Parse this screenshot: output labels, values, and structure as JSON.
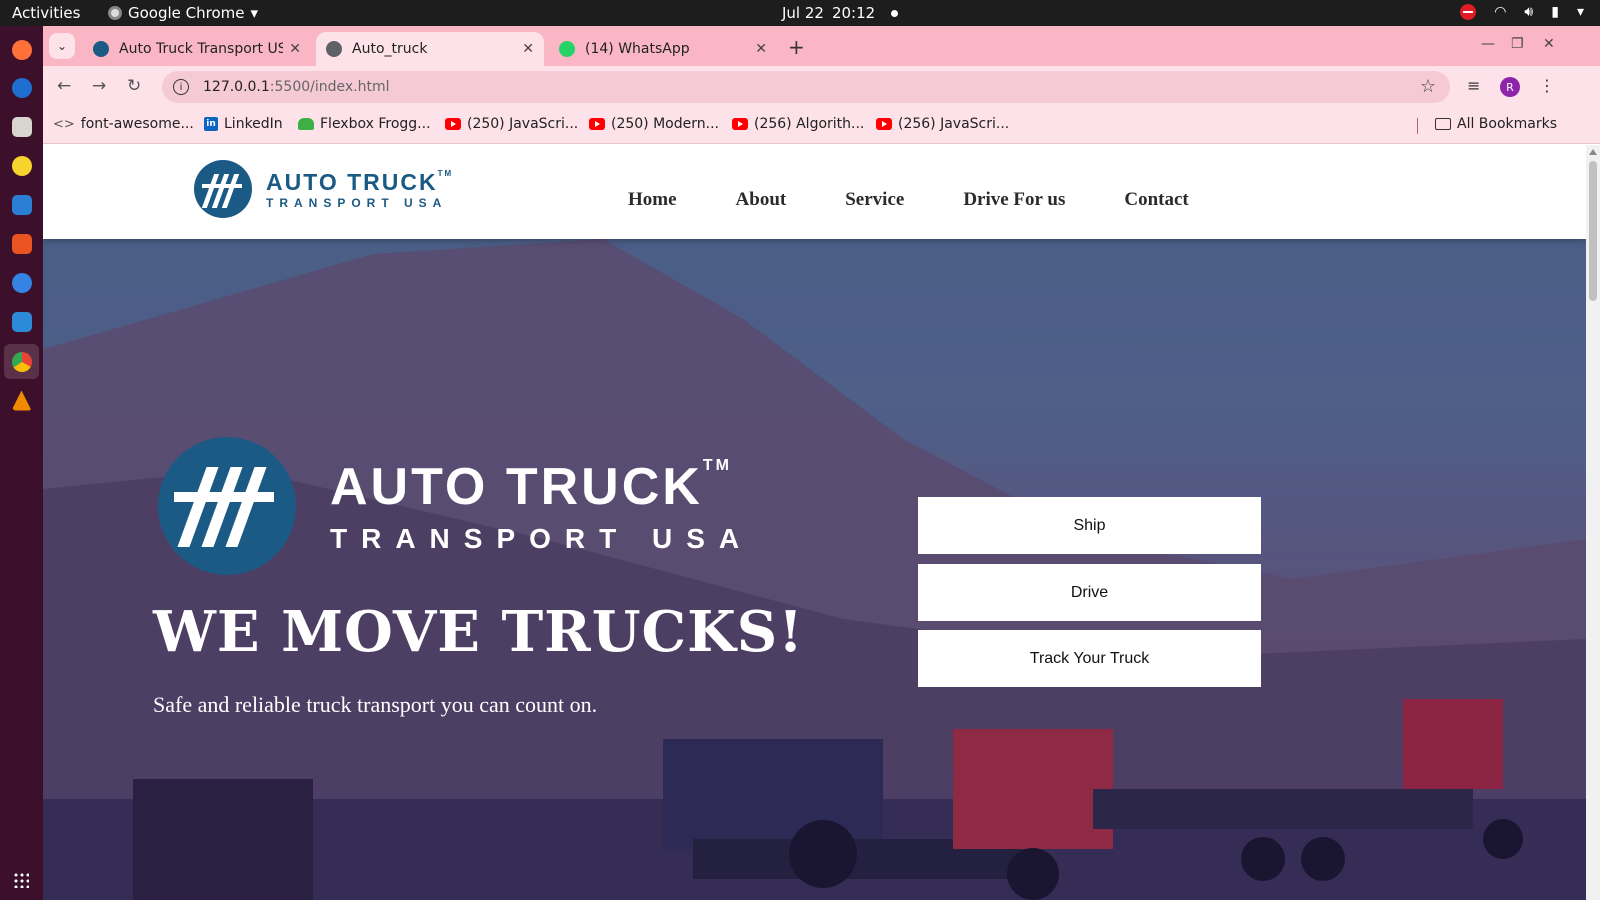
{
  "os": {
    "activities": "Activities",
    "app_name": "Google Chrome",
    "date": "Jul 22",
    "time": "20:12"
  },
  "browser": {
    "tabs": [
      {
        "title": "Auto Truck Transport USA",
        "active": false
      },
      {
        "title": "Auto_truck",
        "active": true
      },
      {
        "title": "(14) WhatsApp",
        "active": false
      }
    ],
    "url_host": "127.0.0.1",
    "url_path": ":5500/index.html",
    "profile_initial": "R",
    "bookmarks": [
      {
        "label": "font-awesome...",
        "icon": "code-icon"
      },
      {
        "label": "LinkedIn",
        "icon": "linkedin-icon"
      },
      {
        "label": "Flexbox Frogg...",
        "icon": "frog-icon"
      },
      {
        "label": "(250) JavaScri...",
        "icon": "youtube-icon"
      },
      {
        "label": "(250) Modern...",
        "icon": "youtube-icon"
      },
      {
        "label": "(256) Algorith...",
        "icon": "youtube-icon"
      },
      {
        "label": "(256) JavaScri...",
        "icon": "youtube-icon"
      }
    ],
    "all_bookmarks": "All Bookmarks"
  },
  "site": {
    "logo": {
      "line1": "AUTO TRUCK",
      "line2": "TRANSPORT USA",
      "tm": "TM"
    },
    "nav": [
      "Home",
      "About",
      "Service",
      "Drive For us",
      "Contact"
    ],
    "hero": {
      "heading": "WE MOVE TRUCKS!",
      "subheading": "Safe and reliable truck transport you can count on.",
      "buttons": [
        "Ship",
        "Drive",
        "Track Your Truck"
      ]
    }
  },
  "colors": {
    "brand_blue": "#1a5a84",
    "tab_strip": "#fbb6c6",
    "hero_overlay": "#4b4f80"
  }
}
